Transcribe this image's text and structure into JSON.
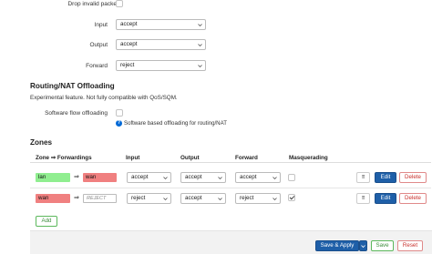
{
  "general": {
    "drop_invalid_label": "Drop invalid packets",
    "input_label": "Input",
    "input_value": "accept",
    "output_label": "Output",
    "output_value": "accept",
    "forward_label": "Forward",
    "forward_value": "reject"
  },
  "offloading": {
    "title": "Routing/NAT Offloading",
    "description": "Experimental feature. Not fully compatible with QoS/SQM.",
    "sw_label": "Software flow offloading",
    "sw_hint": "Software based offloading for routing/NAT"
  },
  "zones": {
    "title": "Zones",
    "headers": {
      "zone": "Zone ⇒ Forwardings",
      "input": "Input",
      "output": "Output",
      "forward": "Forward",
      "masq": "Masquerading"
    },
    "rows": [
      {
        "name": "lan",
        "arrow": "⇒",
        "target": "wan",
        "input": "accept",
        "output": "accept",
        "forward": "accept",
        "masq": false,
        "color": "#90ee90",
        "target_color": "#f08080"
      },
      {
        "name": "wan",
        "arrow": "⇒",
        "target": "REJECT",
        "input": "reject",
        "output": "accept",
        "forward": "reject",
        "masq": true,
        "color": "#f08080"
      }
    ],
    "grip_label": "≡",
    "edit_label": "Edit",
    "delete_label": "Delete",
    "add_label": "Add"
  },
  "footer": {
    "save_apply_label": "Save & Apply",
    "save_label": "Save",
    "reset_label": "Reset"
  }
}
